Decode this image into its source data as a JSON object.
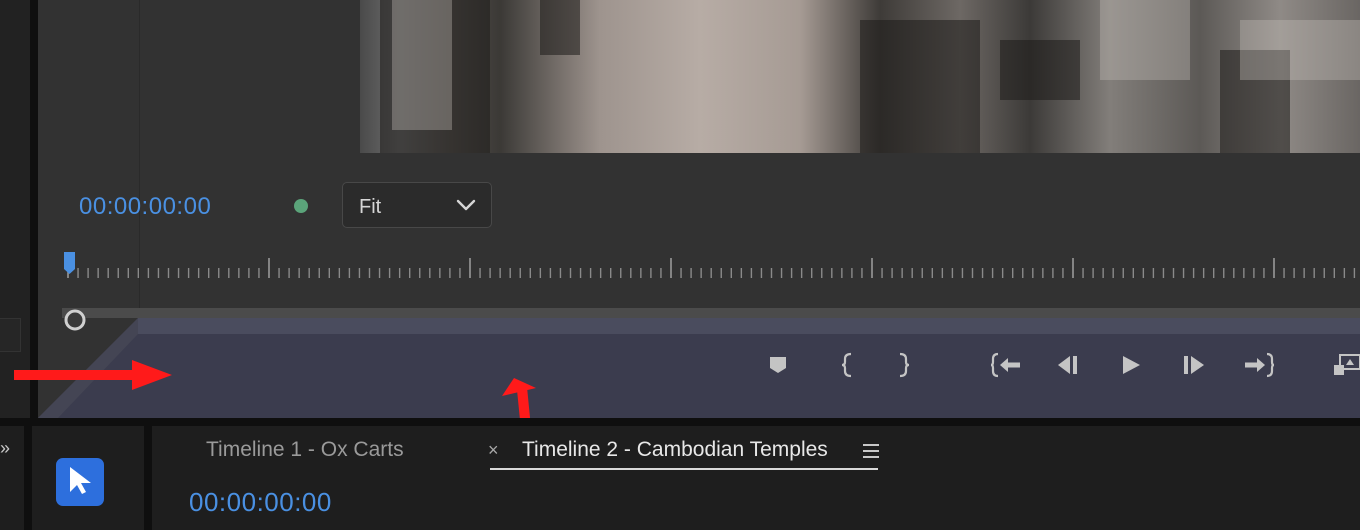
{
  "program_monitor": {
    "timecode": "00:00:00:00",
    "zoom_select": {
      "selected": "Fit"
    },
    "transport_buttons": [
      {
        "name": "add-marker",
        "icon": "marker-icon"
      },
      {
        "name": "mark-in",
        "icon": "mark-in-icon"
      },
      {
        "name": "mark-out",
        "icon": "mark-out-icon"
      },
      {
        "name": "go-to-in",
        "icon": "go-to-in-icon"
      },
      {
        "name": "step-back",
        "icon": "step-back-icon"
      },
      {
        "name": "play",
        "icon": "play-icon"
      },
      {
        "name": "step-forward",
        "icon": "step-forward-icon"
      },
      {
        "name": "go-to-out",
        "icon": "go-to-out-icon"
      },
      {
        "name": "lift",
        "icon": "lift-icon"
      }
    ],
    "status_color": "#5ba47a"
  },
  "timeline_panel": {
    "tabs": [
      {
        "label": "Timeline 1 - Ox Carts",
        "active": false
      },
      {
        "label": "Timeline 2 - Cambodian Temples",
        "active": true
      }
    ],
    "close_symbol": "×",
    "timecode": "00:00:00:00"
  },
  "panel_expand_symbol": "»",
  "colors": {
    "accent": "#4a90e2",
    "annotation_arrow": "#ff1a1a",
    "tool_selected": "#2d6fdd"
  },
  "annotations": [
    {
      "name": "arrow-right",
      "direction": "right"
    },
    {
      "name": "arrow-up",
      "direction": "up"
    }
  ]
}
